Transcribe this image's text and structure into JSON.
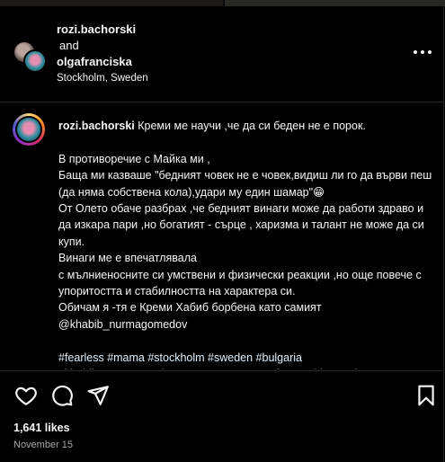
{
  "header": {
    "user1": "rozi.bachorski",
    "and_text": "and",
    "user2": "olgafranciska",
    "location": "Stockholm, Sweden"
  },
  "caption": {
    "username": "rozi.bachorski",
    "first_line": "Креми ме научи ,че да си беден не е порок.",
    "paragraphs": [
      "В противоречие с Майка ми ,\nБаща ми казваше \"бедният човек не е човек,видиш ли го да върви пеш (да няма собствена кола),удари му един шамар\"😁\nОт Олето обаче разбрах ,че бедният винаги може да работи здраво и да изкара пари ,но богатият - сърце , харизма и талант не може да си купи.\nВинаги ме е впечатлявала\nс мълниеносните си умствени и физически реакции ,но още повече с упоритостта и стабилността на характера си.\nОбичам я -тя е Креми Хабиб борбена като самият\n@khabib_nurmagomedov",
      "#fearless #mama #stockholm #sweden #bulgaria\n#khabibnurmagomedov #strong #smart #unforgettable #real"
    ]
  },
  "actions": {
    "icons": [
      "heart-icon",
      "comment-icon",
      "share-icon",
      "bookmark-icon"
    ]
  },
  "likes": "1,641 likes",
  "date": "November 15"
}
